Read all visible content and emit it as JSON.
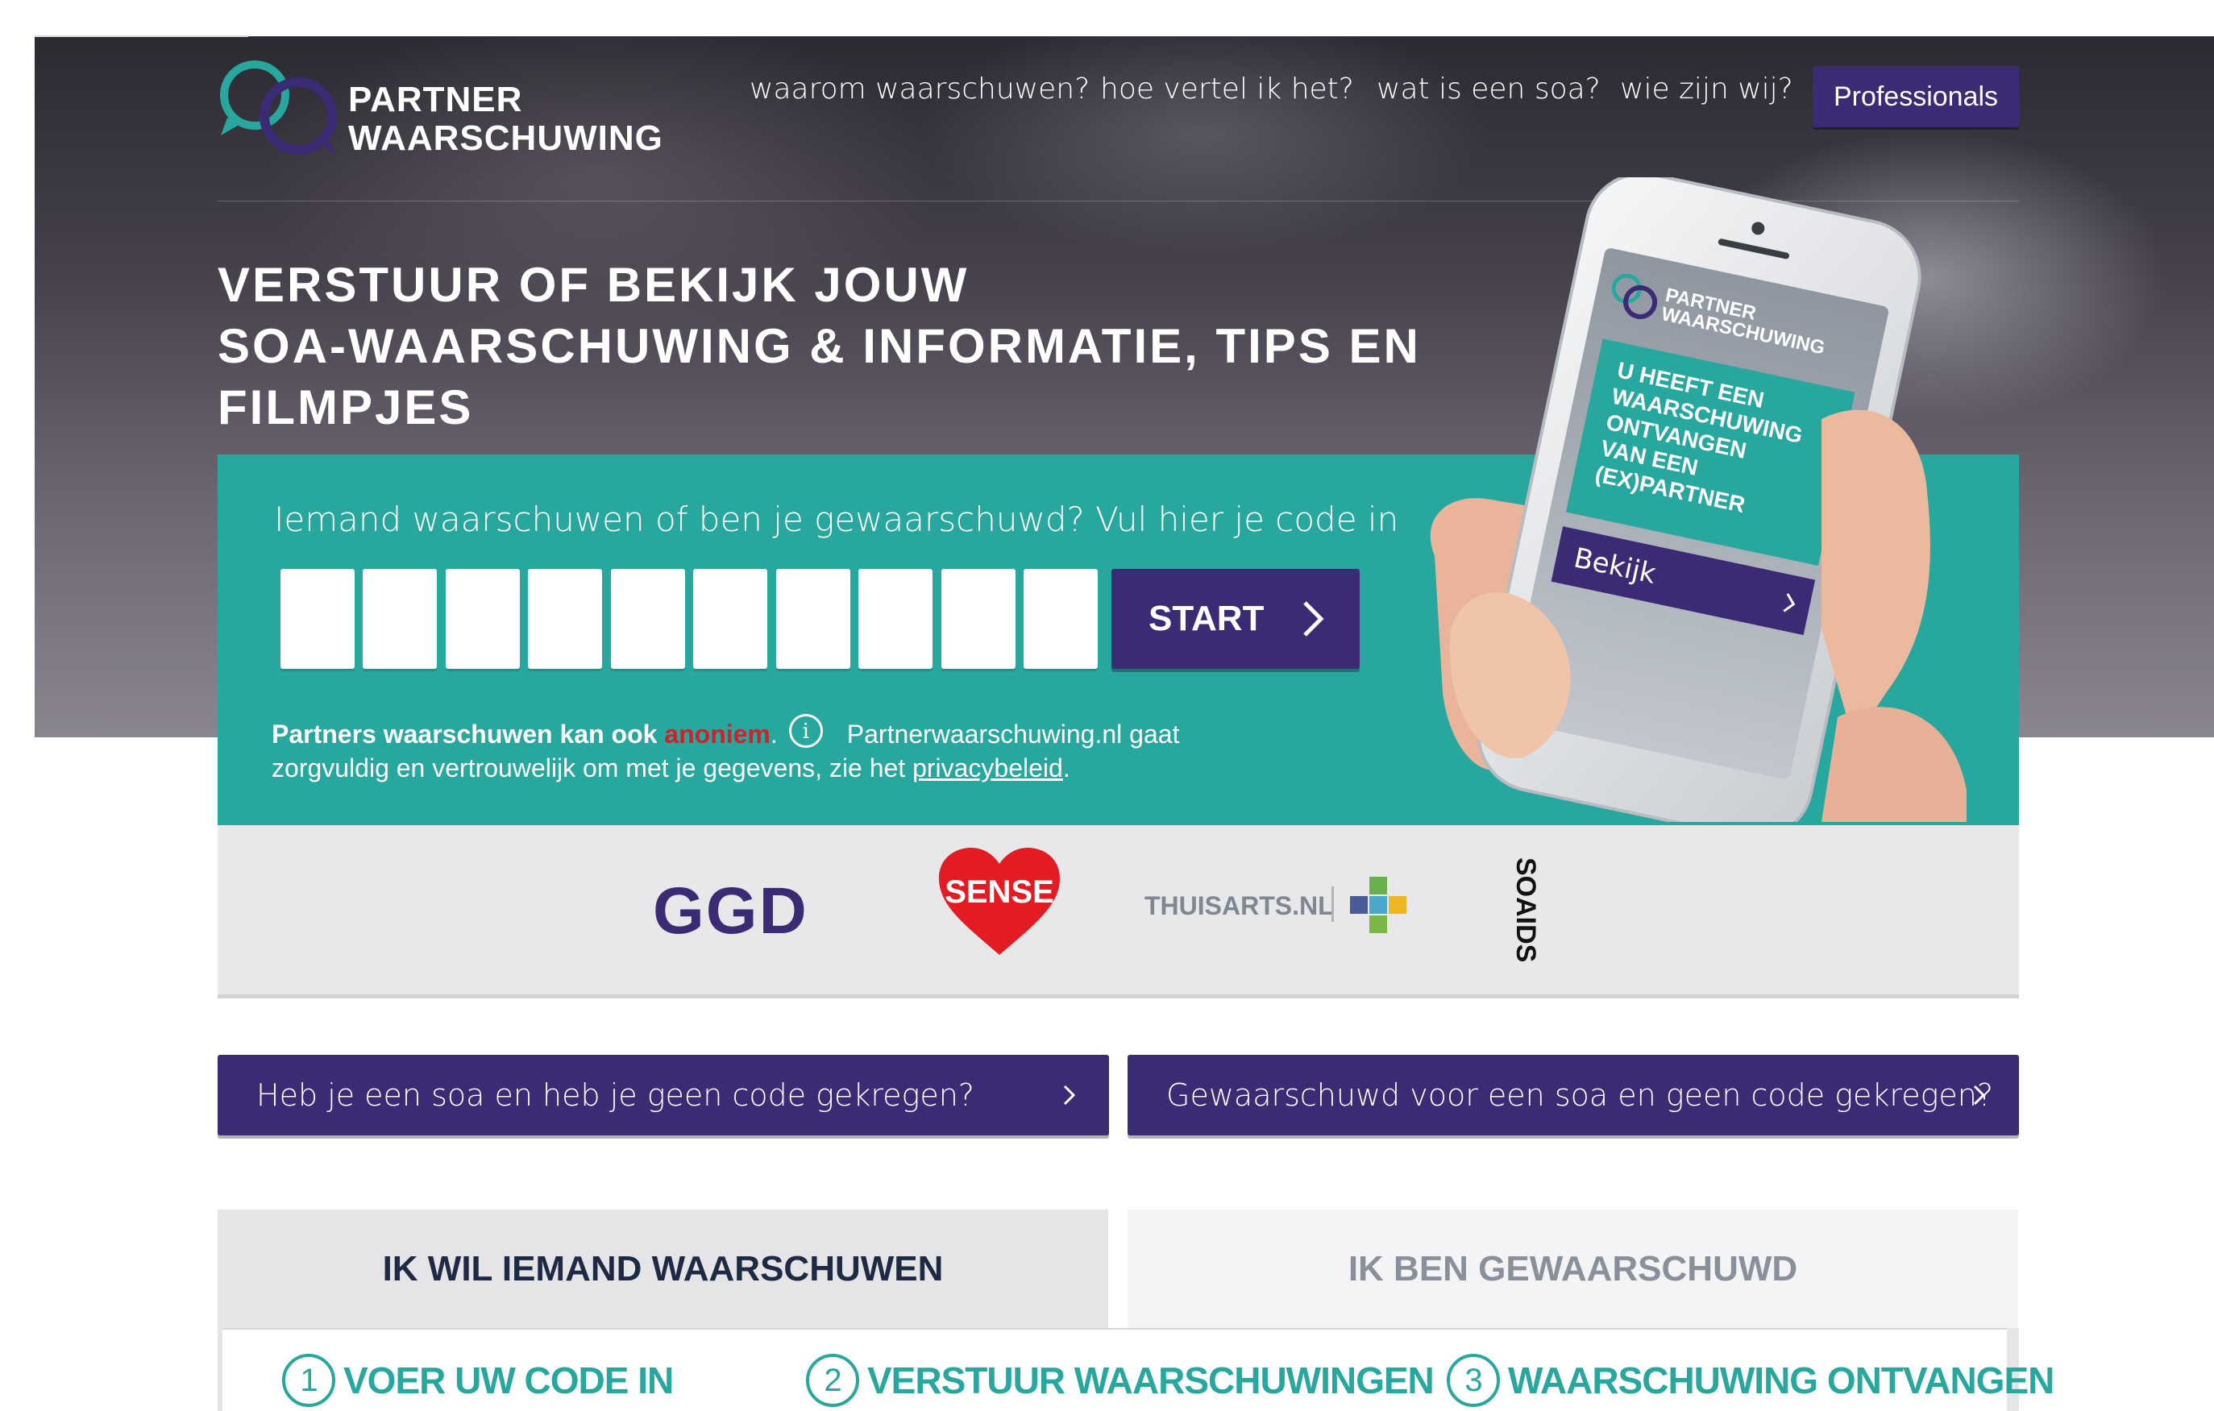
{
  "brand": {
    "line1": "PARTNER",
    "line2": "WAARSCHUWING"
  },
  "nav": {
    "items": [
      {
        "label": "waarom waarschuwen?"
      },
      {
        "label": "hoe vertel ik het?"
      },
      {
        "label": "wat is een soa?"
      },
      {
        "label": "wie zijn wij?"
      }
    ],
    "professionals_label": "Professionals"
  },
  "hero": {
    "headline_line1": "VERSTUUR OF BEKIJK JOUW",
    "headline_line2": "SOA-WAARSCHUWING & INFORMATIE, TIPS EN",
    "headline_line3": "FILMPJES"
  },
  "code_form": {
    "prompt": "Iemand waarschuwen of ben je gewaarschuwd? Vul hier je code in",
    "box_count": 10,
    "start_label": "START",
    "anon_bold": "Partners waarschuwen kan ook ",
    "anon_red": "anoniem",
    "anon_dot": ".",
    "privacy_text_1": "Partnerwaarschuwing.nl gaat",
    "privacy_text_2": "zorgvuldig en vertrouwelijk om met je gegevens, zie het ",
    "privacy_link": "privacybeleid",
    "privacy_end": "."
  },
  "phone": {
    "logo_line1": "PARTNER",
    "logo_line2": "WAARSCHUWING",
    "message_lines": [
      "U HEEFT EEN",
      "WAARSCHUWING",
      "ONTVANGEN",
      "VAN EEN",
      "(EX)PARTNER"
    ],
    "button_label": "Bekijk"
  },
  "partners": {
    "ggd": "GGD",
    "sense": "SENSE",
    "thuisarts": "THUISARTS.NL",
    "soaids": "SOAIDS"
  },
  "links": {
    "no_code_soa": "Heb je een soa en heb je geen code gekregen?",
    "warned_no_code": "Gewaarschuwd voor een soa en geen code gekregen?"
  },
  "tabs": {
    "warn": "IK WIL IEMAND WAARSCHUWEN",
    "warned": "IK BEN GEWAARSCHUWD"
  },
  "steps": [
    {
      "num": "1",
      "label": "VOER UW CODE IN"
    },
    {
      "num": "2",
      "label": "VERSTUUR WAARSCHUWINGEN"
    },
    {
      "num": "3",
      "label": "WAARSCHUWING ONTVANGEN"
    }
  ],
  "colors": {
    "teal": "#27a79d",
    "purple": "#3b2a74",
    "red": "#d0222b"
  }
}
